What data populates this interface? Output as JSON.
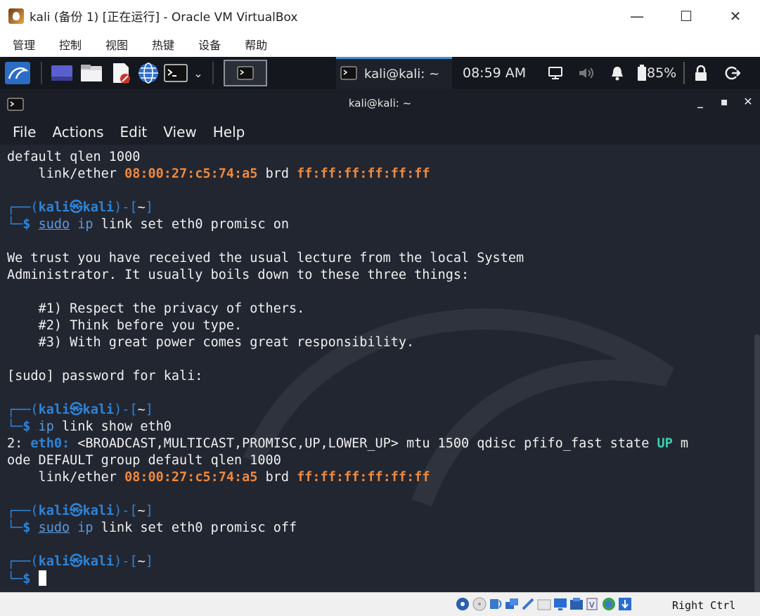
{
  "window": {
    "title": "kali (备份 1) [正在运行] - Oracle VM VirtualBox",
    "minimize": "—",
    "maximize": "☐",
    "close": "✕"
  },
  "vbox_menu": [
    "管理",
    "控制",
    "视图",
    "热键",
    "设备",
    "帮助"
  ],
  "panel": {
    "active_task": "kali@kali: ~",
    "time": "08:59 AM",
    "battery": "85%"
  },
  "terminal": {
    "title": "kali@kali: ~",
    "menu": [
      "File",
      "Actions",
      "Edit",
      "View",
      "Help"
    ],
    "lines": [
      {
        "segs": [
          {
            "t": "default qlen 1000"
          }
        ]
      },
      {
        "segs": [
          {
            "t": "    link/ether "
          },
          {
            "t": "08:00:27:c5:74:a5",
            "c": "orange"
          },
          {
            "t": " brd "
          },
          {
            "t": "ff:ff:ff:ff:ff:ff",
            "c": "orange"
          }
        ]
      },
      {
        "segs": []
      },
      {
        "segs": [
          {
            "t": "┌──(",
            "c": "grayb"
          },
          {
            "t": "kali㉿kali",
            "c": "blue"
          },
          {
            "t": ")-[",
            "c": "grayb"
          },
          {
            "t": "~",
            "c": "bold"
          },
          {
            "t": "]",
            "c": "grayb"
          }
        ]
      },
      {
        "segs": [
          {
            "t": "└─",
            "c": "grayb"
          },
          {
            "t": "$",
            "c": "blue"
          },
          {
            "t": " "
          },
          {
            "t": "sudo",
            "c": "dim ul"
          },
          {
            "t": " "
          },
          {
            "t": "ip",
            "c": "dim"
          },
          {
            "t": " link set eth0 promisc on"
          }
        ]
      },
      {
        "segs": []
      },
      {
        "segs": [
          {
            "t": "We trust you have received the usual lecture from the local System"
          }
        ]
      },
      {
        "segs": [
          {
            "t": "Administrator. It usually boils down to these three things:"
          }
        ]
      },
      {
        "segs": []
      },
      {
        "segs": [
          {
            "t": "    #1) Respect the privacy of others."
          }
        ]
      },
      {
        "segs": [
          {
            "t": "    #2) Think before you type."
          }
        ]
      },
      {
        "segs": [
          {
            "t": "    #3) With great power comes great responsibility."
          }
        ]
      },
      {
        "segs": []
      },
      {
        "segs": [
          {
            "t": "[sudo] password for kali:"
          }
        ]
      },
      {
        "segs": []
      },
      {
        "segs": [
          {
            "t": "┌──(",
            "c": "grayb"
          },
          {
            "t": "kali㉿kali",
            "c": "blue"
          },
          {
            "t": ")-[",
            "c": "grayb"
          },
          {
            "t": "~",
            "c": "bold"
          },
          {
            "t": "]",
            "c": "grayb"
          }
        ]
      },
      {
        "segs": [
          {
            "t": "└─",
            "c": "grayb"
          },
          {
            "t": "$",
            "c": "blue"
          },
          {
            "t": " "
          },
          {
            "t": "ip",
            "c": "dim"
          },
          {
            "t": " link show eth0"
          }
        ]
      },
      {
        "segs": [
          {
            "t": "2: "
          },
          {
            "t": "eth0:",
            "c": "blue"
          },
          {
            "t": " <BROADCAST,MULTICAST,PROMISC,UP,LOWER_UP> mtu 1500 qdisc pfifo_fast state "
          },
          {
            "t": "UP",
            "c": "green"
          },
          {
            "t": " m"
          }
        ]
      },
      {
        "segs": [
          {
            "t": "ode DEFAULT group default qlen 1000"
          }
        ]
      },
      {
        "segs": [
          {
            "t": "    link/ether "
          },
          {
            "t": "08:00:27:c5:74:a5",
            "c": "orange"
          },
          {
            "t": " brd "
          },
          {
            "t": "ff:ff:ff:ff:ff:ff",
            "c": "orange"
          }
        ]
      },
      {
        "segs": []
      },
      {
        "segs": [
          {
            "t": "┌──(",
            "c": "grayb"
          },
          {
            "t": "kali㉿kali",
            "c": "blue"
          },
          {
            "t": ")-[",
            "c": "grayb"
          },
          {
            "t": "~",
            "c": "bold"
          },
          {
            "t": "]",
            "c": "grayb"
          }
        ]
      },
      {
        "segs": [
          {
            "t": "└─",
            "c": "grayb"
          },
          {
            "t": "$",
            "c": "blue"
          },
          {
            "t": " "
          },
          {
            "t": "sudo",
            "c": "dim ul"
          },
          {
            "t": " "
          },
          {
            "t": "ip",
            "c": "dim"
          },
          {
            "t": " link set eth0 promisc off"
          }
        ]
      },
      {
        "segs": []
      },
      {
        "segs": [
          {
            "t": "┌──(",
            "c": "grayb"
          },
          {
            "t": "kali㉿kali",
            "c": "blue"
          },
          {
            "t": ")-[",
            "c": "grayb"
          },
          {
            "t": "~",
            "c": "bold"
          },
          {
            "t": "]",
            "c": "grayb"
          }
        ]
      },
      {
        "segs": [
          {
            "t": "└─",
            "c": "grayb"
          },
          {
            "t": "$",
            "c": "blue"
          },
          {
            "t": " "
          }
        ],
        "cursor": true
      }
    ]
  },
  "statusbar": {
    "host_key": "Right Ctrl"
  }
}
